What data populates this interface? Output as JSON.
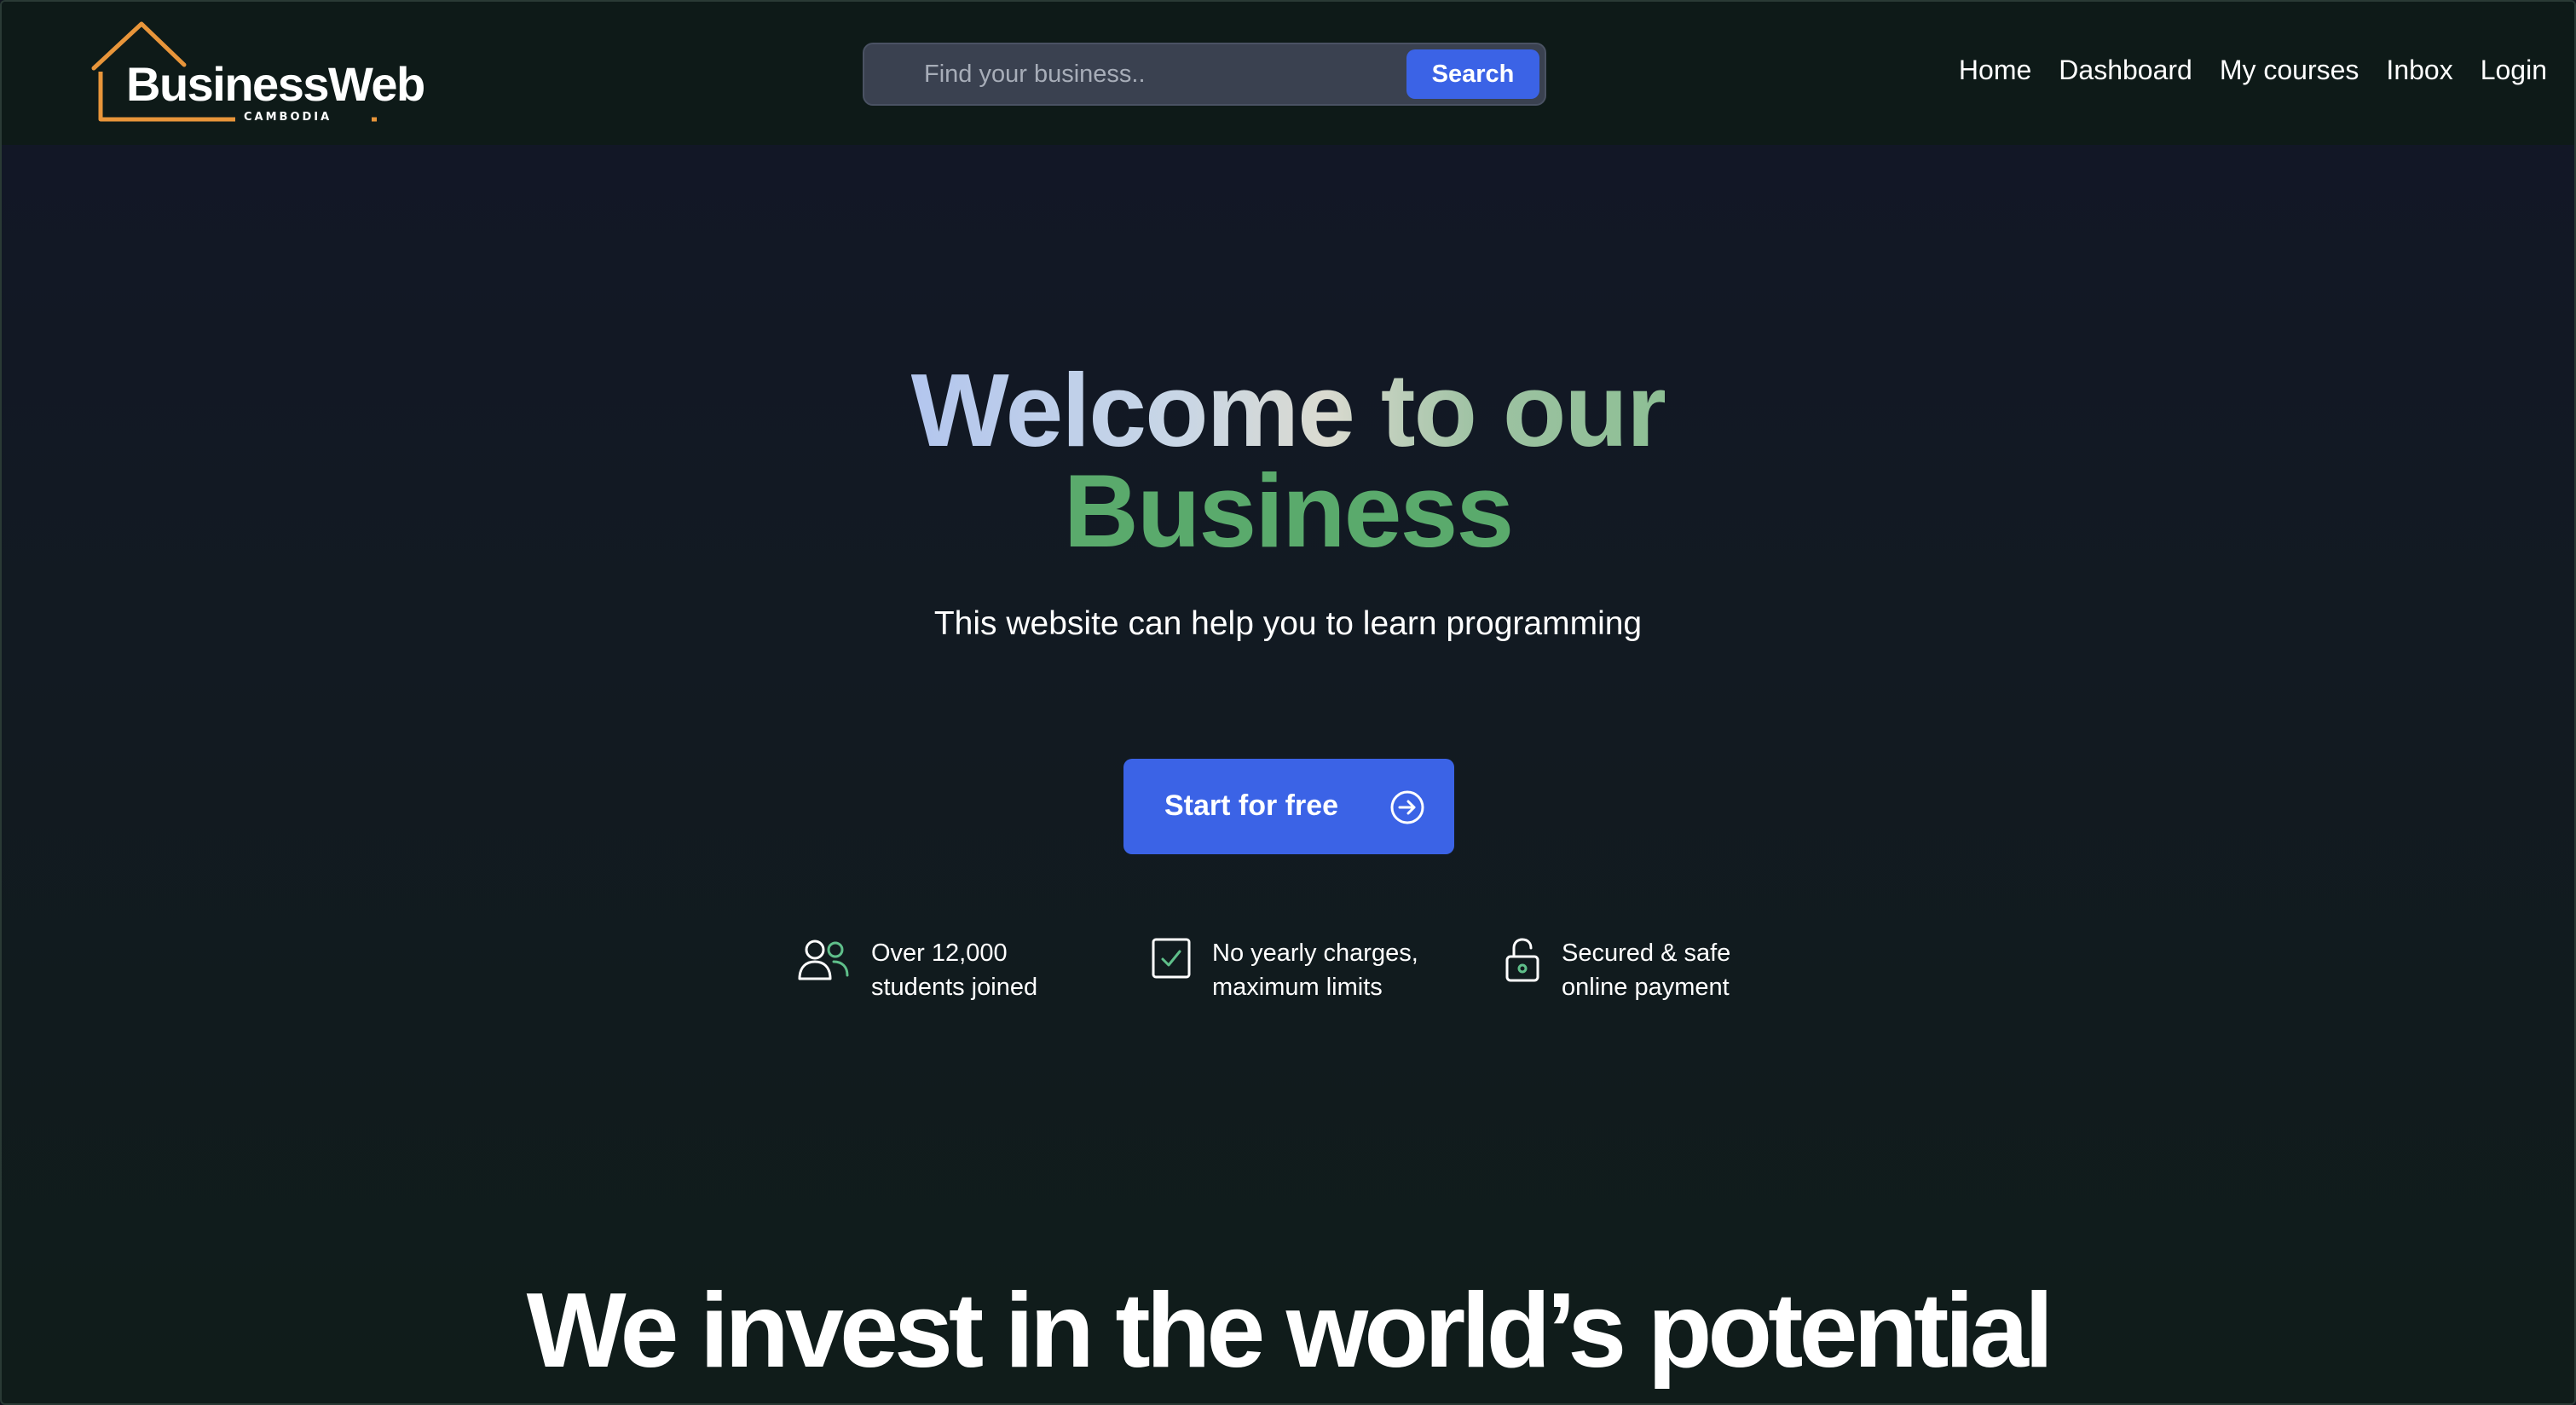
{
  "brand": {
    "name": "BusinessWeb",
    "sub": "CAMBODIA",
    "accent": "#e8953a"
  },
  "search": {
    "placeholder": "Find your business..",
    "button_label": "Search"
  },
  "nav": {
    "items": [
      {
        "label": "Home"
      },
      {
        "label": "Dashboard"
      },
      {
        "label": "My courses"
      },
      {
        "label": "Inbox"
      },
      {
        "label": "Login"
      }
    ]
  },
  "hero": {
    "title_part1": "Welcome to our",
    "title_part2": "Business",
    "subtitle": "This website can help you to learn programming",
    "cta_label": "Start for free",
    "cta_icon": "arrow-circle-right-icon"
  },
  "features": [
    {
      "icon": "users-icon",
      "line1": "Over 12,000",
      "line2": "students joined"
    },
    {
      "icon": "check-square-icon",
      "line1": "No yearly charges,",
      "line2": "maximum limits"
    },
    {
      "icon": "lock-icon",
      "line1": "Secured & safe",
      "line2": "online payment"
    }
  ],
  "section": {
    "heading": "We invest in the world’s potential"
  },
  "colors": {
    "primary": "#3b63e6",
    "icon_accent": "#5fbf8a",
    "background": "#11161f"
  }
}
